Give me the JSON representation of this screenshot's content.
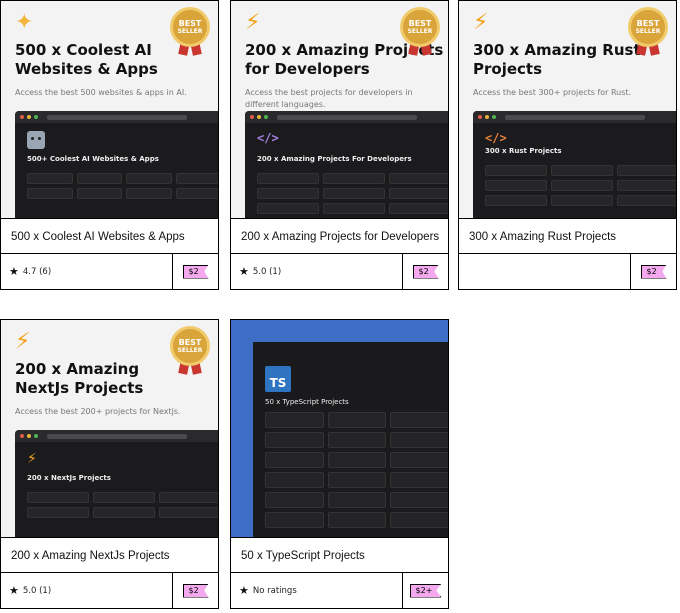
{
  "badge": {
    "line1": "BEST",
    "line2": "SELLER"
  },
  "products": [
    {
      "thumb_title": "500 x Coolest AI Websites & Apps",
      "thumb_subtitle": "Access the best 500 websites & apps in AI.",
      "mock_title": "500+ Coolest AI Websites & Apps",
      "name": "500 x Coolest AI Websites & Apps",
      "rating": "4.7 (6)",
      "price": "$2",
      "icon": "sparkle-icon"
    },
    {
      "thumb_title": "200 x Amazing Projects for Developers",
      "thumb_subtitle": "Access the best projects for developers in different languages.",
      "mock_title": "200 x Amazing Projects For Developers",
      "name": "200 x Amazing Projects for Developers",
      "rating": "5.0 (1)",
      "price": "$2",
      "icon": "lightning-icon"
    },
    {
      "thumb_title": "300 x Amazing Rust Projects",
      "thumb_subtitle": "Access the best 300+ projects for Rust.",
      "mock_title": "300 x Rust Projects",
      "name": "300 x Amazing Rust Projects",
      "rating": "",
      "price": "$2",
      "icon": "lightning-icon"
    },
    {
      "thumb_title": "200 x Amazing NextJs Projects",
      "thumb_subtitle": "Access the best 200+ projects for Nextjs.",
      "mock_title": "200 x NextJs Projects",
      "name": "200 x Amazing NextJs Projects",
      "rating": "5.0 (1)",
      "price": "$2",
      "icon": "lightning-icon"
    },
    {
      "thumb_title": "",
      "thumb_subtitle": "",
      "mock_title": "50 x TypeScript Projects",
      "logo": "TS",
      "name": "50 x TypeScript Projects",
      "rating": "No ratings",
      "price": "$2+",
      "icon": "typescript-logo-icon"
    }
  ]
}
